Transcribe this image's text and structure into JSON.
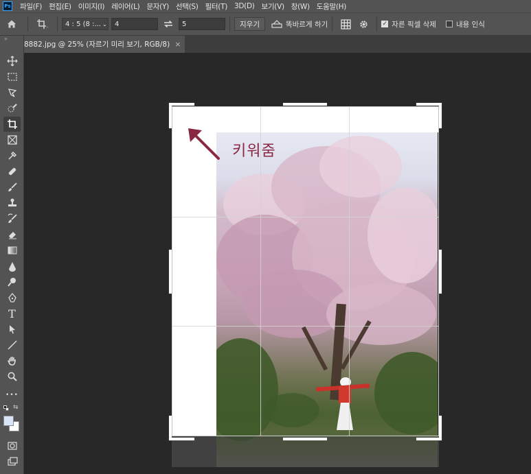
{
  "app": {
    "logo_text": "Ps"
  },
  "menu": [
    "파일(F)",
    "편집(E)",
    "이미지(I)",
    "레이어(L)",
    "문자(Y)",
    "선택(S)",
    "필터(T)",
    "3D(D)",
    "보기(V)",
    "창(W)",
    "도움말(H)"
  ],
  "options": {
    "ratio_select": "4 : 5 (8 :...",
    "width_value": "4",
    "height_value": "5",
    "clear_button": "지우기",
    "straighten_label": "똑바르게 하기",
    "delete_pixels_label": "자른 픽셀 삭제",
    "delete_pixels_checked": true,
    "content_aware_label": "내용 인식",
    "content_aware_checked": false
  },
  "tab": {
    "title": "8882.jpg @ 25% (자르기 미리 보기, RGB/8)",
    "close_glyph": "×"
  },
  "toolbar": {
    "grip": "»",
    "tools": [
      "move-tool",
      "marquee-tool",
      "lasso-tool",
      "quick-select-tool",
      "crop-tool",
      "frame-tool",
      "eyedropper-tool",
      "healing-brush-tool",
      "brush-tool",
      "stamp-tool",
      "history-brush-tool",
      "eraser-tool",
      "gradient-tool",
      "blur-tool",
      "dodge-tool",
      "pen-tool",
      "type-tool",
      "path-select-tool",
      "line-tool",
      "hand-tool",
      "zoom-tool",
      "more-tools"
    ],
    "active_tool": "crop-tool",
    "type_glyph": "T",
    "more_glyph": "•••",
    "foreground_color": "#d8e4f8",
    "background_color": "#ffffff"
  },
  "annotation": {
    "text": "키워줌",
    "color": "#8a2844"
  }
}
